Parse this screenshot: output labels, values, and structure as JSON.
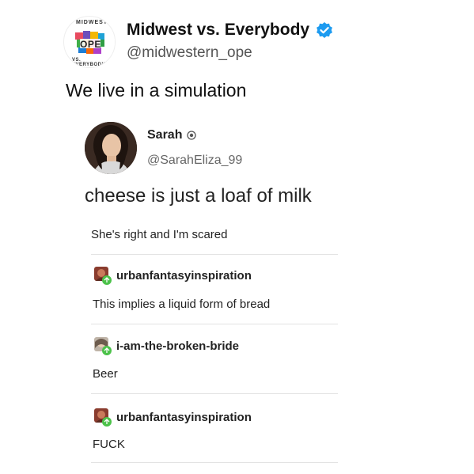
{
  "tweet": {
    "display_name": "Midwest vs. Everybody",
    "handle": "@midwestern_ope",
    "text": "We live in a simulation",
    "avatar_text": "OPE",
    "avatar_ring_top": "MIDWEST",
    "avatar_ring_bottom": "VS. EVERYBODY"
  },
  "embedded": {
    "name": "Sarah",
    "handle": "@SarahEliza_99",
    "text": "cheese is just a loaf of milk",
    "caption": "She's right and I'm scared",
    "replies": [
      {
        "username": "urbanfantasyinspiration",
        "text": "This implies a liquid form of bread"
      },
      {
        "username": "i-am-the-broken-bride",
        "text": "Beer"
      },
      {
        "username": "urbanfantasyinspiration",
        "text": "FUCK"
      }
    ]
  },
  "colors": {
    "verified": "#1d9bf0",
    "reblog_badge": "#4cc24a"
  }
}
